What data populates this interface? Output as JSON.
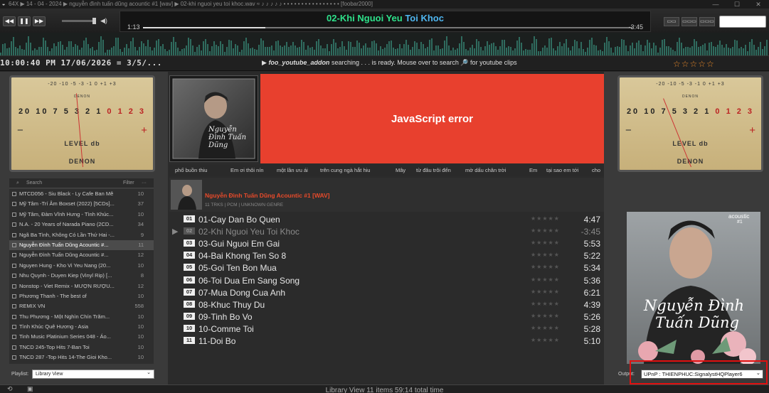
{
  "titlebar": {
    "text": "64X ▶ 14 - 04 - 2024 ▶ nguyễn đình tuấn dũng acountic #1 [wav] ▶ 02-khi nguoi yeu toi khoc.wav ≈ ♪ ♪ ♪ ♪ ♪ • • • • • • • • • • • • • • • • [foobar2000]",
    "minimize": "—",
    "maximize": "☐",
    "close": "✕"
  },
  "toolbar": {
    "prev": "◀◀",
    "pause": "❚❚",
    "next": "▶▶",
    "volume_icon": "◀)",
    "volume_level": 0.85
  },
  "now_playing": {
    "title_part1": "02-Khi Nguoi Yeu ",
    "title_part2": "Toi Khoc",
    "elapsed": "1:13",
    "remaining": "-3:45",
    "progress": 0.25
  },
  "view_buttons": [
    "▭▭",
    "▭▭▭",
    "▭▭▭"
  ],
  "info_line": {
    "clock": "10:00:40 PM   17/06/2026 = 3/5/...",
    "yt_arrow": "▶",
    "yt_addon": "foo_youtube_addon",
    "yt_text": " searching . . . is ready. Mouse over to search 🔎 for youtube clips",
    "stars": "☆☆☆☆☆"
  },
  "vu_meter": {
    "top_scale": "-20 -10 -5  -3  -1  0  +1  +3",
    "brand_top": "DENON",
    "scale": "20  10 7 5  3 2 1",
    "scale_red": " 0  1  2  3",
    "minus": "−",
    "plus": "+",
    "label": "LEVEL db",
    "brand": "DENON"
  },
  "library": {
    "search_placeholder": "Search",
    "filter_label": "Filter",
    "more": "···",
    "items": [
      {
        "name": "MTCD056 - Siu Black - Ly Cafe Ban Mê",
        "count": "10"
      },
      {
        "name": "Mỹ Tâm -Trí Âm Boxset (2022) [5CDs]...",
        "count": "37"
      },
      {
        "name": "Mỹ Tâm, Đàm Vĩnh Hưng - Tình Khúc...",
        "count": "10"
      },
      {
        "name": "N.A. - 20 Years of Narada Piano (2CD...",
        "count": "34"
      },
      {
        "name": "Ngã Ba Tình, Không Có Lần Thứ Hai -...",
        "count": "9"
      },
      {
        "name": "Nguyễn Đình Tuấn Dũng Acountic #...",
        "count": "11"
      },
      {
        "name": "Nguyễn Đình Tuấn Dũng Acountic #...",
        "count": "12"
      },
      {
        "name": "Nguyen Hung - Kho Vi Yeu Nang (20...",
        "count": "10"
      },
      {
        "name": "Nhu Quynh - Duyen Kiep (Vinyl Rip) [...",
        "count": "8"
      },
      {
        "name": "Nonstop - Viet Remix - MƯỢN RƯỢU...",
        "count": "12"
      },
      {
        "name": "Phương Thanh - The best of",
        "count": "10"
      },
      {
        "name": "REMIX VN",
        "count": "558"
      },
      {
        "name": "Thu Phương - Một Nghìn Chín Trăm...",
        "count": "10"
      },
      {
        "name": "Tình Khúc Quê Hương - Asia",
        "count": "10"
      },
      {
        "name": "Tinh Music Platinium Series 048 - Áo...",
        "count": "10"
      },
      {
        "name": "TNCD 245-Top Hits 7-Ban Toi",
        "count": "10"
      },
      {
        "name": "TNCD 287 -Top Hits 14-The Gioi Kho...",
        "count": "10"
      }
    ],
    "selected_index": 5,
    "playlist_label": "Playlist:",
    "playlist_value": "Library View",
    "dropdown": "⌄"
  },
  "center": {
    "js_error": "JavaScript error",
    "ticker": [
      "phố buồn thiu",
      "Em ơi thôi nín",
      "một lần ưu ái",
      "trên cung ngà hắt hiu",
      "Mây",
      "từ đâu trôi đến",
      "mờ dấu chân trời",
      "Em",
      "tại sao em tới",
      "cho"
    ],
    "album_title": "Nguyễn Đình Tuấn Dũng Acountic #1 [WAV]",
    "album_sub": "11 TRKS | PCM | UNKNOWN GENRE",
    "play_marker": "▶",
    "track_stars": "★★★★★",
    "tracks": [
      {
        "num": "01",
        "title": "01-Cay Dan Bo Quen",
        "dur": "4:47"
      },
      {
        "num": "02",
        "title": "02-Khi Nguoi Yeu Toi Khoc",
        "dur": "-3:45"
      },
      {
        "num": "03",
        "title": "03-Gui Nguoi Em Gai",
        "dur": "5:53"
      },
      {
        "num": "04",
        "title": "04-Bai Khong Ten So 8",
        "dur": "5:22"
      },
      {
        "num": "05",
        "title": "05-Goi Ten Bon Mua",
        "dur": "5:34"
      },
      {
        "num": "06",
        "title": "06-Toi Dua Em Sang Song",
        "dur": "5:36"
      },
      {
        "num": "07",
        "title": "07-Mua Dong Cua Anh",
        "dur": "6:21"
      },
      {
        "num": "08",
        "title": "08-Khuc Thuy Du",
        "dur": "4:39"
      },
      {
        "num": "09",
        "title": "09-Tinh Bo Vo",
        "dur": "5:26"
      },
      {
        "num": "10",
        "title": "10-Comme Toi",
        "dur": "5:28"
      },
      {
        "num": "11",
        "title": "11-Doi Bo",
        "dur": "5:10"
      }
    ],
    "playing_index": 1
  },
  "right": {
    "art_caption": "acoustic",
    "art_caption2": "#1",
    "art_name1": "Nguyễn Đình",
    "art_name2": "Tuấn Dũng",
    "small_art_name": "Nguyễn Đình Tuấn Dũng",
    "output_label": "Output:",
    "output_value": "UPnP : THIENPHUC:SignalystHQPlayer6",
    "dropdown": "⌄"
  },
  "status": {
    "text": "Library View    11 items    59:14 total time"
  },
  "colors": {
    "accent_green": "#2ee08a",
    "error_red": "#e8402e",
    "album_title": "#e84a2a",
    "highlight_box": "#e01010"
  }
}
